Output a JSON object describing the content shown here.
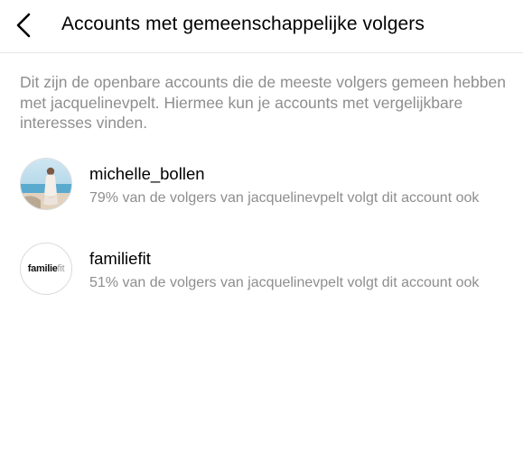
{
  "header": {
    "back_icon": "chevron-left-icon",
    "title": "Accounts met gemeenschappelijke volgers"
  },
  "description": "Dit zijn de openbare accounts die de meeste volgers gemeen hebben met jacquelinevpelt. Hiermee kun je accounts met vergelijkbare interesses vinden.",
  "accounts": [
    {
      "username": "michelle_bollen",
      "subtitle": "79% van de volgers van jacquelinevpelt volgt dit account ook",
      "avatar": "beach-photo-avatar"
    },
    {
      "username": "familiefit",
      "subtitle": "51% van de volgers van jacquelinevpelt volgt dit account ook",
      "avatar": "familiefit-logo-avatar",
      "logo_bold": "familie",
      "logo_light": "fit"
    }
  ]
}
